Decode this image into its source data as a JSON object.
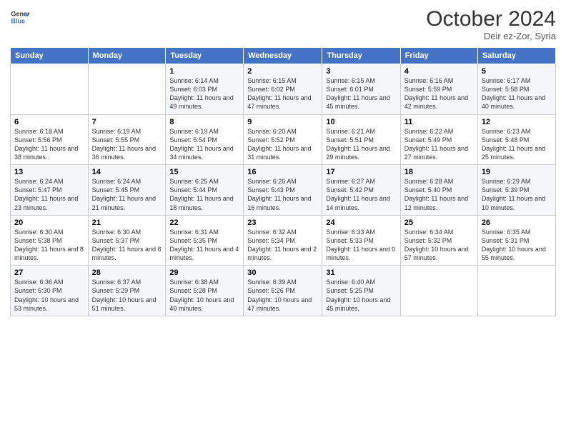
{
  "header": {
    "month_title": "October 2024",
    "location": "Deir ez-Zor, Syria",
    "logo_general": "General",
    "logo_blue": "Blue"
  },
  "days_of_week": [
    "Sunday",
    "Monday",
    "Tuesday",
    "Wednesday",
    "Thursday",
    "Friday",
    "Saturday"
  ],
  "weeks": [
    [
      {
        "day": "",
        "detail": ""
      },
      {
        "day": "",
        "detail": ""
      },
      {
        "day": "1",
        "detail": "Sunrise: 6:14 AM\nSunset: 6:03 PM\nDaylight: 11 hours and 49 minutes."
      },
      {
        "day": "2",
        "detail": "Sunrise: 6:15 AM\nSunset: 6:02 PM\nDaylight: 11 hours and 47 minutes."
      },
      {
        "day": "3",
        "detail": "Sunrise: 6:15 AM\nSunset: 6:01 PM\nDaylight: 11 hours and 45 minutes."
      },
      {
        "day": "4",
        "detail": "Sunrise: 6:16 AM\nSunset: 5:59 PM\nDaylight: 11 hours and 42 minutes."
      },
      {
        "day": "5",
        "detail": "Sunrise: 6:17 AM\nSunset: 5:58 PM\nDaylight: 11 hours and 40 minutes."
      }
    ],
    [
      {
        "day": "6",
        "detail": "Sunrise: 6:18 AM\nSunset: 5:56 PM\nDaylight: 11 hours and 38 minutes."
      },
      {
        "day": "7",
        "detail": "Sunrise: 6:19 AM\nSunset: 5:55 PM\nDaylight: 11 hours and 36 minutes."
      },
      {
        "day": "8",
        "detail": "Sunrise: 6:19 AM\nSunset: 5:54 PM\nDaylight: 11 hours and 34 minutes."
      },
      {
        "day": "9",
        "detail": "Sunrise: 6:20 AM\nSunset: 5:52 PM\nDaylight: 11 hours and 31 minutes."
      },
      {
        "day": "10",
        "detail": "Sunrise: 6:21 AM\nSunset: 5:51 PM\nDaylight: 11 hours and 29 minutes."
      },
      {
        "day": "11",
        "detail": "Sunrise: 6:22 AM\nSunset: 5:49 PM\nDaylight: 11 hours and 27 minutes."
      },
      {
        "day": "12",
        "detail": "Sunrise: 6:23 AM\nSunset: 5:48 PM\nDaylight: 11 hours and 25 minutes."
      }
    ],
    [
      {
        "day": "13",
        "detail": "Sunrise: 6:24 AM\nSunset: 5:47 PM\nDaylight: 11 hours and 23 minutes."
      },
      {
        "day": "14",
        "detail": "Sunrise: 6:24 AM\nSunset: 5:45 PM\nDaylight: 11 hours and 21 minutes."
      },
      {
        "day": "15",
        "detail": "Sunrise: 6:25 AM\nSunset: 5:44 PM\nDaylight: 11 hours and 18 minutes."
      },
      {
        "day": "16",
        "detail": "Sunrise: 6:26 AM\nSunset: 5:43 PM\nDaylight: 11 hours and 16 minutes."
      },
      {
        "day": "17",
        "detail": "Sunrise: 6:27 AM\nSunset: 5:42 PM\nDaylight: 11 hours and 14 minutes."
      },
      {
        "day": "18",
        "detail": "Sunrise: 6:28 AM\nSunset: 5:40 PM\nDaylight: 11 hours and 12 minutes."
      },
      {
        "day": "19",
        "detail": "Sunrise: 6:29 AM\nSunset: 5:39 PM\nDaylight: 11 hours and 10 minutes."
      }
    ],
    [
      {
        "day": "20",
        "detail": "Sunrise: 6:30 AM\nSunset: 5:38 PM\nDaylight: 11 hours and 8 minutes."
      },
      {
        "day": "21",
        "detail": "Sunrise: 6:30 AM\nSunset: 5:37 PM\nDaylight: 11 hours and 6 minutes."
      },
      {
        "day": "22",
        "detail": "Sunrise: 6:31 AM\nSunset: 5:35 PM\nDaylight: 11 hours and 4 minutes."
      },
      {
        "day": "23",
        "detail": "Sunrise: 6:32 AM\nSunset: 5:34 PM\nDaylight: 11 hours and 2 minutes."
      },
      {
        "day": "24",
        "detail": "Sunrise: 6:33 AM\nSunset: 5:33 PM\nDaylight: 11 hours and 0 minutes."
      },
      {
        "day": "25",
        "detail": "Sunrise: 6:34 AM\nSunset: 5:32 PM\nDaylight: 10 hours and 57 minutes."
      },
      {
        "day": "26",
        "detail": "Sunrise: 6:35 AM\nSunset: 5:31 PM\nDaylight: 10 hours and 55 minutes."
      }
    ],
    [
      {
        "day": "27",
        "detail": "Sunrise: 6:36 AM\nSunset: 5:30 PM\nDaylight: 10 hours and 53 minutes."
      },
      {
        "day": "28",
        "detail": "Sunrise: 6:37 AM\nSunset: 5:29 PM\nDaylight: 10 hours and 51 minutes."
      },
      {
        "day": "29",
        "detail": "Sunrise: 6:38 AM\nSunset: 5:28 PM\nDaylight: 10 hours and 49 minutes."
      },
      {
        "day": "30",
        "detail": "Sunrise: 6:39 AM\nSunset: 5:26 PM\nDaylight: 10 hours and 47 minutes."
      },
      {
        "day": "31",
        "detail": "Sunrise: 6:40 AM\nSunset: 5:25 PM\nDaylight: 10 hours and 45 minutes."
      },
      {
        "day": "",
        "detail": ""
      },
      {
        "day": "",
        "detail": ""
      }
    ]
  ]
}
